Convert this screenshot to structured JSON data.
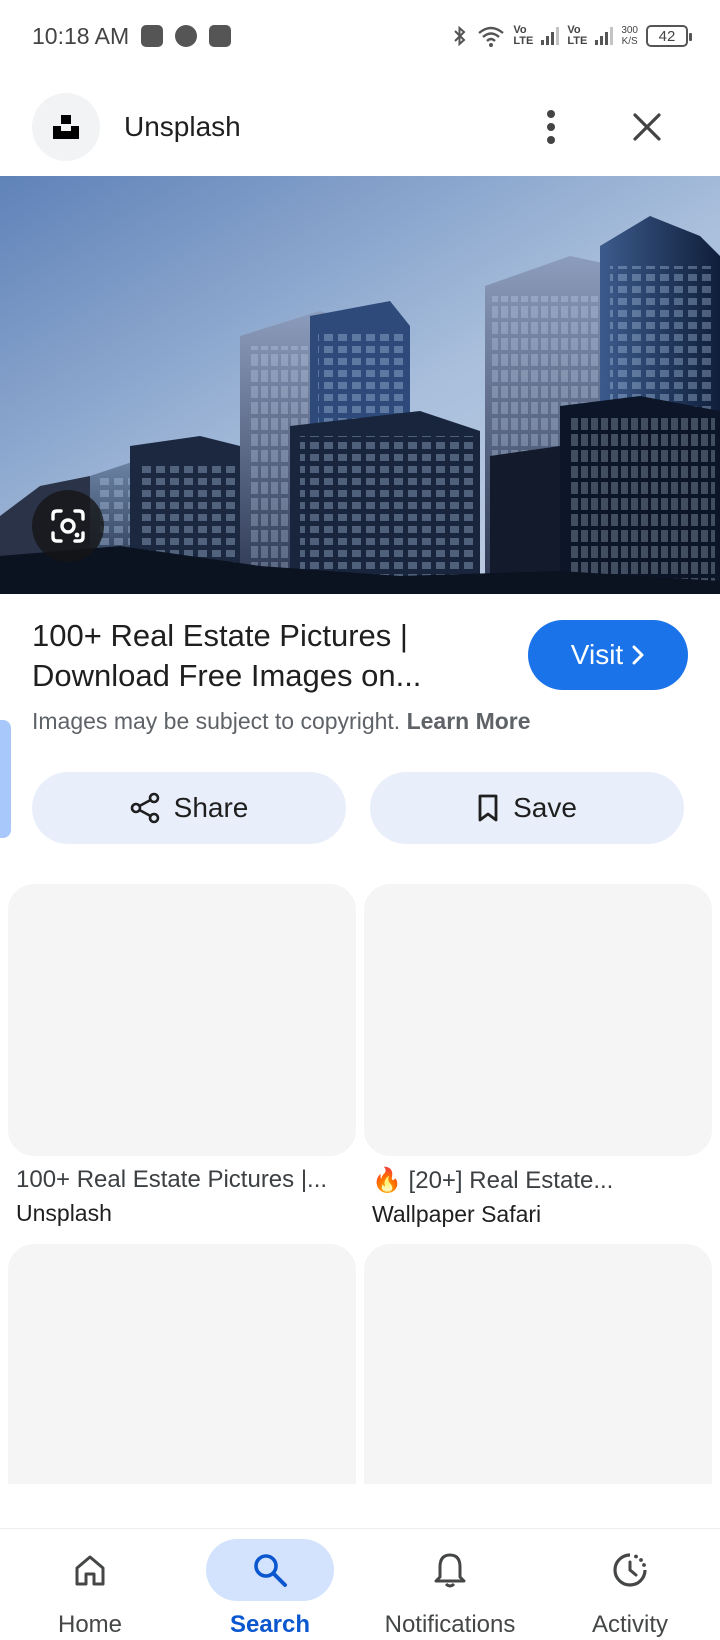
{
  "status_bar": {
    "time": "10:18 AM",
    "volte_1_top": "Vo",
    "volte_1_bottom": "LTE",
    "volte_2_top": "Vo",
    "volte_2_bottom": "LTE",
    "speed_value": "300",
    "speed_unit": "K/S",
    "battery": "42"
  },
  "header": {
    "site_name": "Unsplash"
  },
  "result": {
    "title": "100+ Real Estate Pictures | Download Free Images on...",
    "visit_label": "Visit",
    "copyright_text": "Images may be subject to copyright.",
    "learn_more": "Learn More",
    "share_label": "Share",
    "save_label": "Save"
  },
  "related": [
    {
      "title": "100+ Real Estate Pictures |...",
      "source": "Unsplash"
    },
    {
      "title": "🔥 [20+] Real Estate...",
      "source": "Wallpaper Safari"
    }
  ],
  "bottom_nav": {
    "items": [
      {
        "label": "Home",
        "icon": "home-icon",
        "active": false
      },
      {
        "label": "Search",
        "icon": "search-icon",
        "active": true
      },
      {
        "label": "Notifications",
        "icon": "bell-icon",
        "active": false
      },
      {
        "label": "Activity",
        "icon": "activity-icon",
        "active": false
      }
    ]
  },
  "colors": {
    "accent": "#1a73e8",
    "pill_bg": "#e8eefa",
    "nav_active_bg": "#d3e3fd",
    "nav_active_text": "#0b57d0"
  }
}
